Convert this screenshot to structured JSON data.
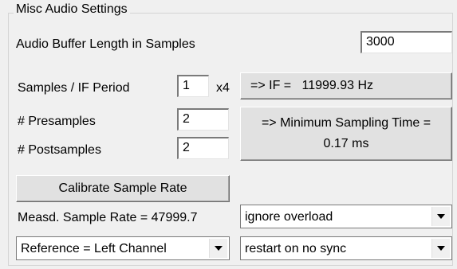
{
  "group": {
    "title": "Misc Audio Settings"
  },
  "buffer": {
    "label": "Audio Buffer Length in Samples",
    "value": "3000"
  },
  "samples_if": {
    "label": "Samples / IF Period",
    "value": "1",
    "suffix": "x4"
  },
  "if_button": {
    "label": "=> IF =   11999.93 Hz"
  },
  "presamples": {
    "label": "# Presamples",
    "value": "2"
  },
  "postsamples": {
    "label": "# Postsamples",
    "value": "2"
  },
  "min_sampling_button": {
    "line1": "=> Minimum Sampling Time =",
    "line2": "0.17 ms"
  },
  "calibrate_button": {
    "label": "Calibrate Sample Rate"
  },
  "measured_rate": {
    "label": "Measd. Sample Rate = 47999.7"
  },
  "overload_select": {
    "value": "ignore overload"
  },
  "reference_select": {
    "value": "Reference = Left Channel"
  },
  "sync_select": {
    "value": "restart on no sync"
  }
}
